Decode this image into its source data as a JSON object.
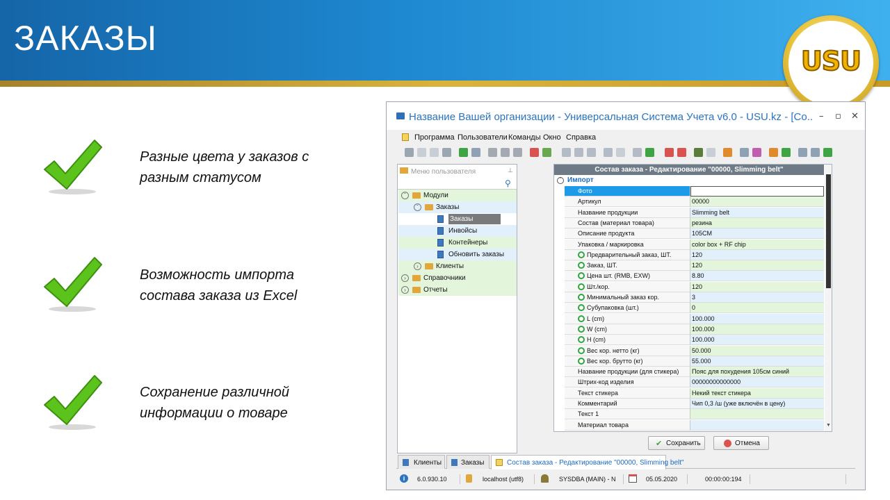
{
  "slide": {
    "title": "ЗАКАЗЫ",
    "logo_text": "USU",
    "features": [
      {
        "line1": "Разные цвета у заказов с",
        "line2": "разным статусом"
      },
      {
        "line1": "Возможность импорта",
        "line2": "состава заказа из Excel"
      },
      {
        "line1": "Сохранение различной",
        "line2": "информации о товаре"
      }
    ]
  },
  "window": {
    "title": "Название Вашей организации - Универсальная Система Учета v6.0 - USU.kz - [Co...",
    "controls": {
      "minimize": "–",
      "maximize": "▫",
      "close": "✕"
    },
    "menu": [
      "Программа",
      "Пользователи",
      "Команды",
      "Окно",
      "Справка"
    ],
    "sidebar": {
      "header": "Меню пользователя",
      "tree": [
        {
          "label": "Модули",
          "level": 0,
          "icon": "folder-icon",
          "expanded": true
        },
        {
          "label": "Заказы",
          "level": 1,
          "icon": "folder-icon",
          "expanded": true
        },
        {
          "label": "Заказы",
          "level": 2,
          "icon": "document-icon",
          "selected": true
        },
        {
          "label": "Инвойсы",
          "level": 2,
          "icon": "document-icon"
        },
        {
          "label": "Контейнеры",
          "level": 2,
          "icon": "document-icon"
        },
        {
          "label": "Обновить заказы",
          "level": 2,
          "icon": "document-icon"
        },
        {
          "label": "Клиенты",
          "level": 1,
          "icon": "folder-icon"
        },
        {
          "label": "Справочники",
          "level": 0,
          "icon": "folder-icon"
        },
        {
          "label": "Отчеты",
          "level": 0,
          "icon": "folder-icon"
        }
      ]
    },
    "form": {
      "header": "Состав заказа - Редактирование \"00000, Slimming belt\"",
      "group": "Импорт",
      "rows": [
        {
          "label": "Фото",
          "value": "",
          "plus": false,
          "highlight": true
        },
        {
          "label": "Артикул",
          "value": "00000",
          "plus": false
        },
        {
          "label": "Название продукции",
          "value": "Slimming belt",
          "plus": false
        },
        {
          "label": "Состав (материал товара)",
          "value": "резина",
          "plus": false
        },
        {
          "label": "Описание продукта",
          "value": "105CM",
          "plus": false
        },
        {
          "label": "Упаковка / маркировка",
          "value": "color box + RF chip",
          "plus": false
        },
        {
          "label": "Предварительный заказ, ШТ.",
          "value": "120",
          "plus": true
        },
        {
          "label": "Заказ, ШТ.",
          "value": "120",
          "plus": true
        },
        {
          "label": "Цена шт. (RMB, EXW)",
          "value": "8.80",
          "plus": true
        },
        {
          "label": "Шт./кор.",
          "value": "120",
          "plus": true
        },
        {
          "label": "Минимальный заказ кор.",
          "value": "3",
          "plus": true
        },
        {
          "label": "Субупаковка (шт.)",
          "value": "0",
          "plus": true
        },
        {
          "label": "L (cm)",
          "value": "100.000",
          "plus": true
        },
        {
          "label": "W (cm)",
          "value": "100.000",
          "plus": true
        },
        {
          "label": "H (cm)",
          "value": "100.000",
          "plus": true
        },
        {
          "label": "Вес кор. нетто (кг)",
          "value": "50.000",
          "plus": true
        },
        {
          "label": "Вес кор. брутто (кг)",
          "value": "55.000",
          "plus": true
        },
        {
          "label": "Название продукции (для стикера)",
          "value": "Пояс для похудения 105см синий",
          "plus": false
        },
        {
          "label": "Штрих-код изделия",
          "value": "00000000000000",
          "plus": false
        },
        {
          "label": "Текст стикера",
          "value": "Некий текст стикера",
          "plus": false
        },
        {
          "label": "Комментарий",
          "value": "Чип 0,3 /ш (уже включён в цену)",
          "plus": false
        },
        {
          "label": "Текст 1",
          "value": "",
          "plus": false
        },
        {
          "label": "Материал товара",
          "value": "",
          "plus": false
        }
      ],
      "save_label": "Сохранить",
      "cancel_label": "Отмена"
    },
    "tabs": [
      {
        "label": "Клиенты",
        "active": false
      },
      {
        "label": "Заказы",
        "active": false
      },
      {
        "label": "Состав заказа - Редактирование \"00000, Slimming belt\"",
        "active": true
      }
    ],
    "status": {
      "version": "6.0.930.10",
      "db": "localhost (utf8)",
      "user": "SYSDBA (MAIN) - N",
      "date": "05.05.2020",
      "timer": "00:00:00:194"
    }
  },
  "colors": {
    "header_blue": "#1e88d0",
    "gold": "#d9b33a",
    "row_green": "#e3f6dc",
    "row_blue": "#e2f0fb",
    "selected": "#1e9be8",
    "check_green": "#5cc21c"
  }
}
